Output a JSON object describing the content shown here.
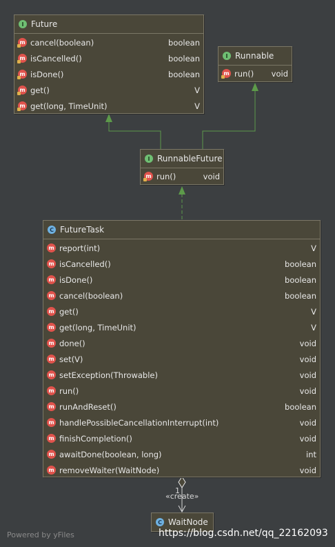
{
  "nodes": {
    "future": {
      "title": "Future",
      "kind_icon": "I",
      "methods": [
        {
          "name": "cancel(boolean)",
          "ret": "boolean"
        },
        {
          "name": "isCancelled()",
          "ret": "boolean"
        },
        {
          "name": "isDone()",
          "ret": "boolean"
        },
        {
          "name": "get()",
          "ret": "V"
        },
        {
          "name": "get(long, TimeUnit)",
          "ret": "V"
        }
      ]
    },
    "runnable": {
      "title": "Runnable",
      "kind_icon": "I",
      "methods": [
        {
          "name": "run()",
          "ret": "void"
        }
      ]
    },
    "runnable_future": {
      "title": "RunnableFuture",
      "kind_icon": "I",
      "methods": [
        {
          "name": "run()",
          "ret": "void"
        }
      ]
    },
    "future_task": {
      "title": "FutureTask",
      "kind_icon": "C",
      "methods": [
        {
          "name": "report(int)",
          "ret": "V"
        },
        {
          "name": "isCancelled()",
          "ret": "boolean"
        },
        {
          "name": "isDone()",
          "ret": "boolean"
        },
        {
          "name": "cancel(boolean)",
          "ret": "boolean"
        },
        {
          "name": "get()",
          "ret": "V"
        },
        {
          "name": "get(long, TimeUnit)",
          "ret": "V"
        },
        {
          "name": "done()",
          "ret": "void"
        },
        {
          "name": "set(V)",
          "ret": "void"
        },
        {
          "name": "setException(Throwable)",
          "ret": "void"
        },
        {
          "name": "run()",
          "ret": "void"
        },
        {
          "name": "runAndReset()",
          "ret": "boolean"
        },
        {
          "name": "handlePossibleCancellationInterrupt(int)",
          "ret": "void"
        },
        {
          "name": "finishCompletion()",
          "ret": "void"
        },
        {
          "name": "awaitDone(boolean, long)",
          "ret": "int"
        },
        {
          "name": "removeWaiter(WaitNode)",
          "ret": "void"
        }
      ]
    },
    "wait_node": {
      "title": "WaitNode",
      "kind_icon": "C"
    }
  },
  "edge_labels": {
    "multiplicity": "1",
    "stereotype": "«create»"
  },
  "method_icon_letter": "m",
  "footer": "Powered by yFiles",
  "watermark": "https://blog.csdn.net/qq_22162093",
  "colors": {
    "background": "#3c3f41",
    "node_fill": "#4a4739",
    "node_border": "#7b7766",
    "generalization_edge": "#5d9a4a",
    "method_icon": "#e0534c",
    "interface_badge": "#6fbf73",
    "class_badge": "#6fb1e0"
  }
}
